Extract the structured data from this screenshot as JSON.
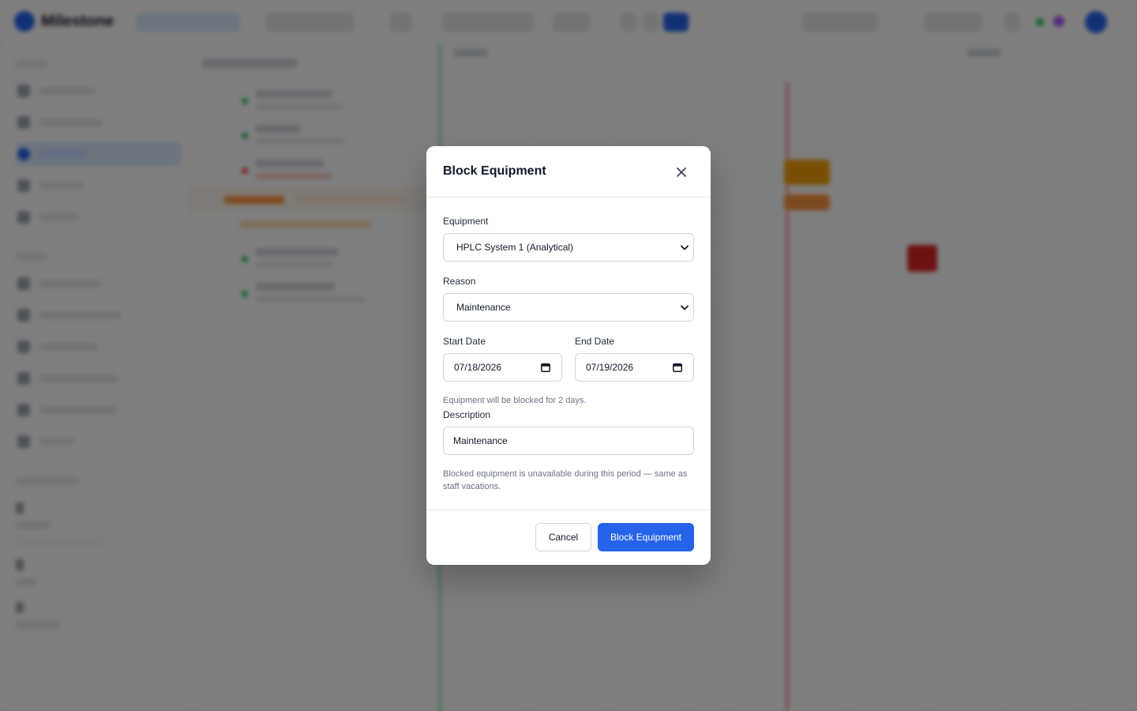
{
  "modal": {
    "title": "Block Equipment",
    "equipment_label": "Equipment",
    "equipment_value": "HPLC System 1 (Analytical)",
    "reason_label": "Reason",
    "reason_value": "Maintenance",
    "start_label": "Start Date",
    "start_value": "07/18/2026",
    "end_label": "End Date",
    "end_value": "07/19/2026",
    "duration_hint": "Equipment will be blocked for 2 days.",
    "description_label": "Description",
    "description_value": "Maintenance",
    "footnote": "Blocked equipment is unavailable during this period — same as staff vacations.",
    "cancel_label": "Cancel",
    "submit_label": "Block Equipment"
  },
  "app": {
    "logo": "Milestone",
    "colors": {
      "primary": "#2563eb",
      "warning": "#f59e0b",
      "danger": "#dc2626",
      "success": "#22c55e"
    }
  }
}
